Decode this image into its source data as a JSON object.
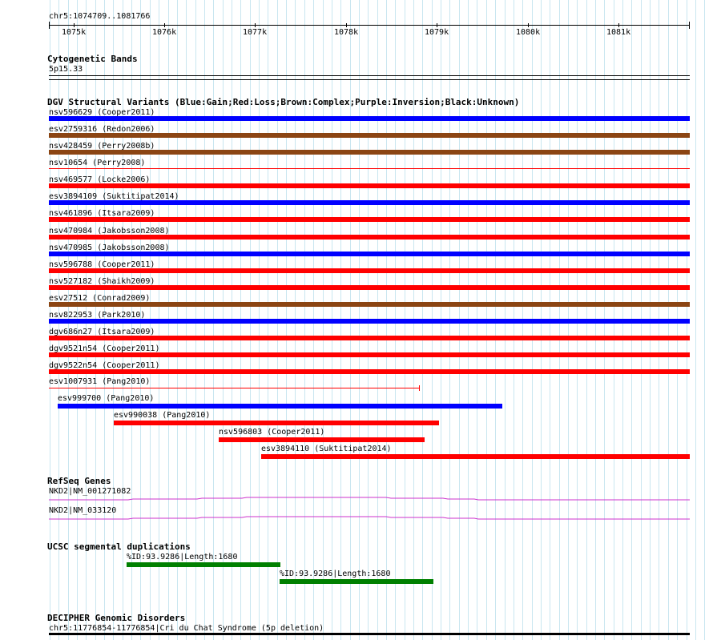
{
  "locus": "chr5:1074709..1081766",
  "ruler": {
    "ticks": [
      "1075k",
      "1076k",
      "1077k",
      "1078k",
      "1079k",
      "1080k",
      "1081k"
    ]
  },
  "cytoband": {
    "title": "Cytogenetic Bands",
    "label": "5p15.33"
  },
  "dgv": {
    "title": "DGV Structural Variants (Blue:Gain;Red:Loss;Brown:Complex;Purple:Inversion;Black:Unknown)",
    "colors": {
      "blue": "#0000ff",
      "red": "#ff0000",
      "brown": "#8b4513",
      "black": "#000000"
    },
    "full_rows": [
      {
        "label": "nsv596629 (Cooper2011)",
        "color": "blue"
      },
      {
        "label": "esv2759316 (Redon2006)",
        "color": "brown"
      },
      {
        "label": "nsv428459 (Perry2008b)",
        "color": "brown"
      },
      {
        "label": "nsv10654 (Perry2008)",
        "color": "red-thin"
      },
      {
        "label": "nsv469577 (Locke2006)",
        "color": "red"
      },
      {
        "label": "esv3894109 (Suktitipat2014)",
        "color": "blue"
      },
      {
        "label": "nsv461896 (Itsara2009)",
        "color": "red"
      },
      {
        "label": "nsv470984 (Jakobsson2008)",
        "color": "red"
      },
      {
        "label": "nsv470985 (Jakobsson2008)",
        "color": "blue"
      },
      {
        "label": "nsv596788 (Cooper2011)",
        "color": "red"
      },
      {
        "label": "nsv527182 (Shaikh2009)",
        "color": "red"
      },
      {
        "label": "esv27512 (Conrad2009)",
        "color": "brown"
      },
      {
        "label": "nsv822953 (Park2010)",
        "color": "blue"
      },
      {
        "label": "dgv686n27 (Itsara2009)",
        "color": "red"
      },
      {
        "label": "dgv9521n54 (Cooper2011)",
        "color": "red"
      },
      {
        "label": "dgv9522n54 (Cooper2011)",
        "color": "red"
      }
    ],
    "partial_rows": [
      {
        "label": "esv1007931 (Pang2010)",
        "color": "red-thin"
      },
      {
        "label": "esv999700 (Pang2010)",
        "color": "blue"
      },
      {
        "label": "esv990038 (Pang2010)",
        "color": "red"
      },
      {
        "label": "nsv596803 (Cooper2011)",
        "color": "red"
      },
      {
        "label": "esv3894110 (Suktitipat2014)",
        "color": "red"
      }
    ]
  },
  "refseq": {
    "title": "RefSeq Genes",
    "genes": [
      "NKD2|NM_001271082",
      "NKD2|NM_033120"
    ],
    "color": "#cc33cc"
  },
  "segdup": {
    "title": "UCSC segmental duplications",
    "items": [
      "%ID:93.9286|Length:1680",
      "%ID:93.9286|Length:1680"
    ],
    "color": "#008000"
  },
  "decipher": {
    "title": "DECIPHER Genomic Disorders",
    "label": "chr5:11776854-11776854|Cri du Chat Syndrome (5p deletion)"
  }
}
